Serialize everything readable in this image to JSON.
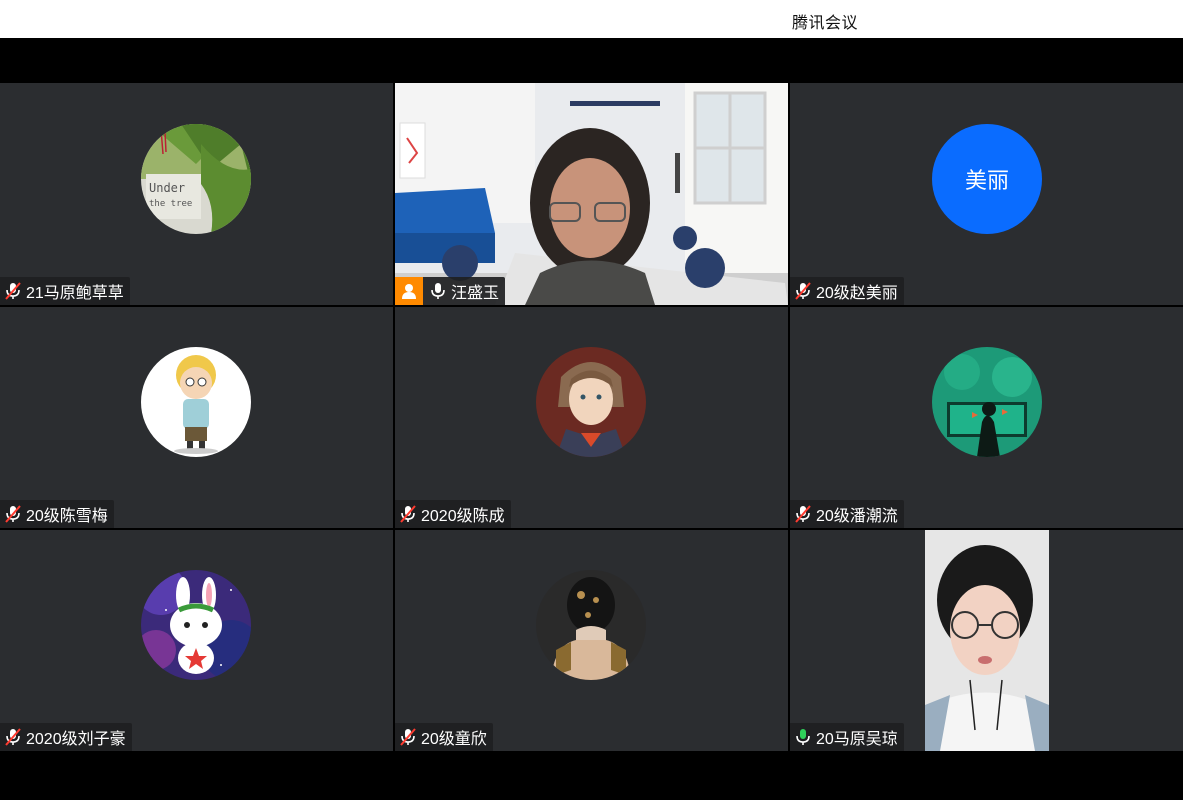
{
  "app": {
    "title": "腾讯会议"
  },
  "colors": {
    "tile_bg": "#2b2d30",
    "active_border": "#3fbf6a",
    "host_badge": "#ff8a00",
    "avatar_blue": "#0a6cff",
    "mic_muted": "#ff3b30",
    "mic_active": "#2fd05a"
  },
  "participants": [
    {
      "name": "21马原鲍草草",
      "mic": "muted",
      "avatar": "tree-photo-avatar"
    },
    {
      "name": "汪盛玉",
      "mic": "on",
      "host": true,
      "video": true
    },
    {
      "name": "20级赵美丽",
      "mic": "muted",
      "avatar_text": "美丽"
    },
    {
      "name": "20级陈雪梅",
      "mic": "muted",
      "avatar": "cartoon-kid-avatar"
    },
    {
      "name": "2020级陈成",
      "mic": "muted",
      "avatar": "anime-man-avatar"
    },
    {
      "name": "20级潘潮流",
      "mic": "muted",
      "avatar": "aquarium-avatar"
    },
    {
      "name": "2020级刘子豪",
      "mic": "muted",
      "avatar": "rabbit-avatar"
    },
    {
      "name": "20级童欣",
      "mic": "muted",
      "avatar": "woman-back-avatar"
    },
    {
      "name": "20马原吴琼",
      "mic": "active",
      "video": true,
      "speaking": true
    }
  ]
}
